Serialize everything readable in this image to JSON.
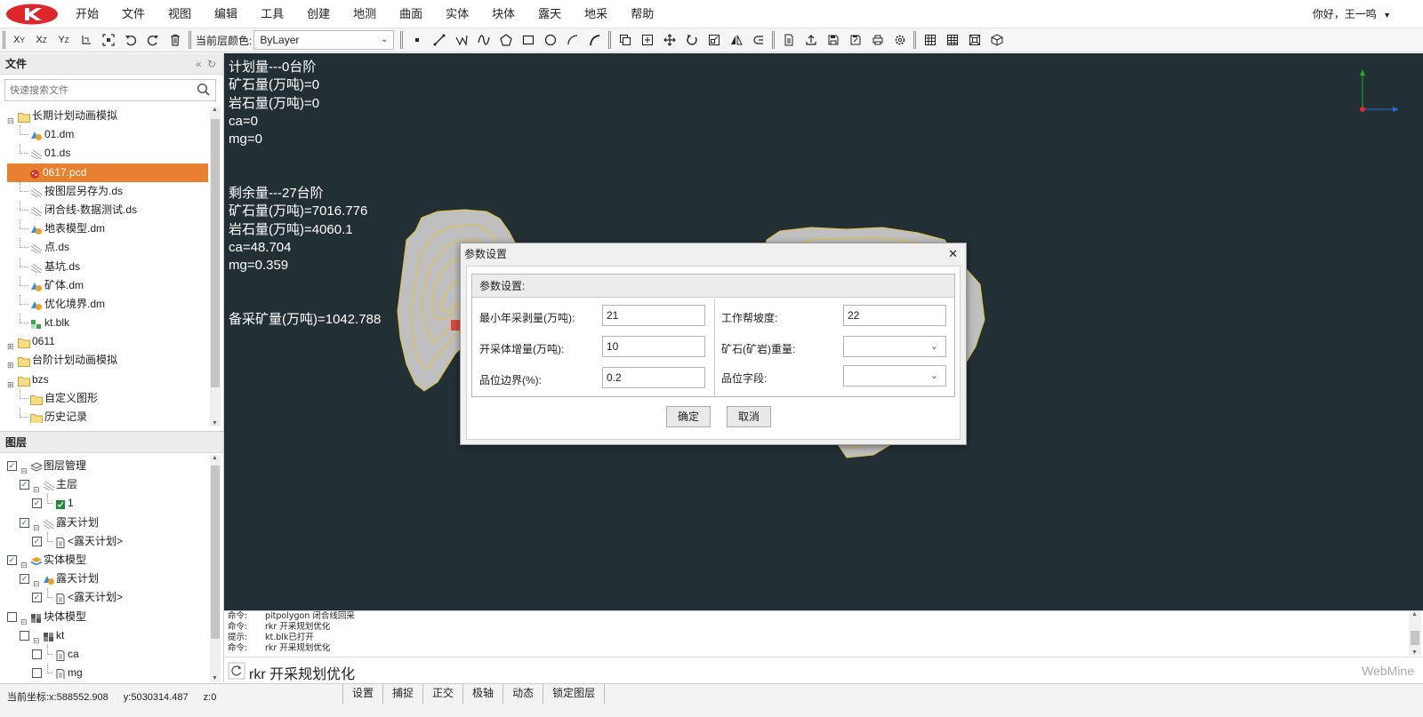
{
  "menu": [
    "开始",
    "文件",
    "视图",
    "编辑",
    "工具",
    "创建",
    "地测",
    "曲面",
    "实体",
    "块体",
    "露天",
    "地采",
    "帮助"
  ],
  "user": {
    "greeting": "你好，王一鸣"
  },
  "toolbar": {
    "axis_buttons": [
      "Xᵧ",
      "Xᵩ",
      "Yᵩ"
    ],
    "layer_color_label": "当前层颜色:",
    "layer_color_value": "ByLayer"
  },
  "file_panel": {
    "title": "文件",
    "search_placeholder": "快速搜索文件",
    "tree": [
      {
        "label": "长期计划动画模拟",
        "icon": "folder",
        "level": 0,
        "expand": "-"
      },
      {
        "label": "01.dm",
        "icon": "dm",
        "level": 1
      },
      {
        "label": "01.ds",
        "icon": "ds",
        "level": 1
      },
      {
        "label": "0617.pcd",
        "icon": "pcd",
        "level": 1,
        "selected": true
      },
      {
        "label": "按图层另存为.ds",
        "icon": "ds",
        "level": 1
      },
      {
        "label": "闭合线-数据测试.ds",
        "icon": "ds",
        "level": 1
      },
      {
        "label": "地表模型.dm",
        "icon": "dm",
        "level": 1
      },
      {
        "label": "点.ds",
        "icon": "ds",
        "level": 1
      },
      {
        "label": "基坑.ds",
        "icon": "ds",
        "level": 1
      },
      {
        "label": "矿体.dm",
        "icon": "dm",
        "level": 1
      },
      {
        "label": "优化境界.dm",
        "icon": "dm",
        "level": 1
      },
      {
        "label": "kt.blk",
        "icon": "blk",
        "level": 1
      },
      {
        "label": "0611",
        "icon": "folder",
        "level": 0,
        "expand": "+"
      },
      {
        "label": "台阶计划动画模拟",
        "icon": "folder",
        "level": 0,
        "expand": "+"
      },
      {
        "label": "bzs",
        "icon": "folder",
        "level": 0,
        "expand": "+"
      },
      {
        "label": "自定义图形",
        "icon": "folder",
        "level": 1
      },
      {
        "label": "历史记录",
        "icon": "folder",
        "level": 1
      }
    ]
  },
  "layer_panel": {
    "title": "图层",
    "tree": [
      {
        "label": "图层管理",
        "icon": "layers",
        "level": 0,
        "checked": true
      },
      {
        "label": "主层",
        "icon": "ds",
        "level": 1,
        "checked": true
      },
      {
        "label": "1",
        "icon": "greenbox",
        "level": 2,
        "checked": true
      },
      {
        "label": "露天计划",
        "icon": "ds",
        "level": 1,
        "checked": true
      },
      {
        "label": "<露天计划>",
        "icon": "doc",
        "level": 2,
        "checked": true
      },
      {
        "label": "实体模型",
        "icon": "solid",
        "level": 0,
        "checked": true
      },
      {
        "label": "露天计划",
        "icon": "dm",
        "level": 1,
        "checked": true
      },
      {
        "label": "<露天计划>",
        "icon": "doc",
        "level": 2,
        "checked": true
      },
      {
        "label": "块体模型",
        "icon": "block",
        "level": 0,
        "checked": false
      },
      {
        "label": "kt",
        "icon": "block",
        "level": 1,
        "checked": false
      },
      {
        "label": "ca",
        "icon": "doc",
        "level": 2,
        "checked": false
      },
      {
        "label": "mg",
        "icon": "doc",
        "level": 2,
        "checked": false
      }
    ]
  },
  "viewport": {
    "info_lines": [
      "计划量---0台阶",
      "矿石量(万吨)=0",
      "岩石量(万吨)=0",
      "ca=0",
      "mg=0",
      "",
      "",
      "剩余量---27台阶",
      "矿石量(万吨)=7016.776",
      "岩石量(万吨)=4060.1",
      "ca=48.704",
      "mg=0.359",
      "",
      "",
      "备采矿量(万吨)=1042.788"
    ],
    "background": "#223036"
  },
  "dialog": {
    "title": "参数设置",
    "group_title": "参数设置:",
    "fields": {
      "min_strip": {
        "label": "最小年采剥量(万吨):",
        "value": "21"
      },
      "increment": {
        "label": "开采体增量(万吨):",
        "value": "10"
      },
      "grade_boundary": {
        "label": "品位边界(%):",
        "value": "0.2"
      },
      "slope": {
        "label": "工作帮坡度:",
        "value": "22"
      },
      "density": {
        "label": "矿石(矿岩)重量:",
        "value": ""
      },
      "grade_field": {
        "label": "品位字段:",
        "value": ""
      }
    },
    "ok": "确定",
    "cancel": "取消"
  },
  "command_log": [
    {
      "key": "命令:",
      "text": "pitpolygon 闭合线回采"
    },
    {
      "key": "命令:",
      "text": "rkr 开采规划优化"
    },
    {
      "key": "提示:",
      "text": "kt.blk已打开"
    },
    {
      "key": "命令:",
      "text": "rkr 开采规划优化"
    }
  ],
  "command_input": "rkr 开采规划优化",
  "brand": "WebMine",
  "status": {
    "x": "当前坐标:x:588552.908",
    "y": "y:5030314.487",
    "z": "z:0",
    "buttons": [
      "设置",
      "捕捉",
      "正交",
      "极轴",
      "动态",
      "锁定图层"
    ]
  },
  "colors": {
    "accent": "#e8812f",
    "logo_red": "#e0262d",
    "viewport_bg": "#223036",
    "pit_gray": "#bfbfbf",
    "pit_outline": "#e2c23a"
  }
}
